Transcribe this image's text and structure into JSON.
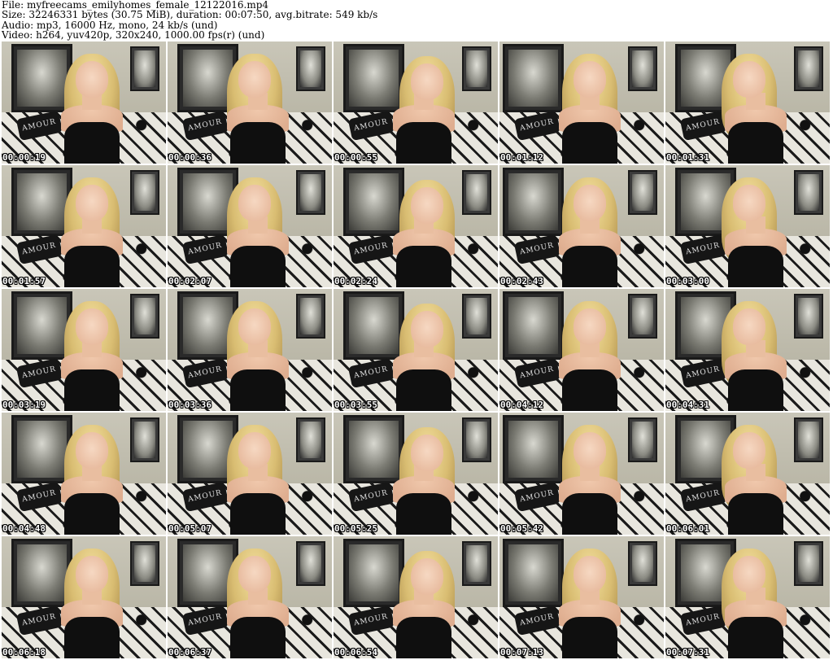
{
  "header": {
    "file_line": "File: myfreecams_emilyhomes_female_12122016.mp4",
    "size_line": "Size: 32246331 bytes (30.75 MiB), duration: 00:07:50, avg.bitrate: 549 kb/s",
    "audio_line": "Audio: mp3, 16000 Hz, mono, 24 kb/s (und)",
    "video_line": "Video: h264, yuv420p, 320x240, 1000.00 fps(r) (und)"
  },
  "thumbnail_text": {
    "pillow_text": "AMOUR"
  },
  "thumbnails": [
    {
      "timestamp": "00:00:19"
    },
    {
      "timestamp": "00:00:36"
    },
    {
      "timestamp": "00:00:55"
    },
    {
      "timestamp": "00:01:12"
    },
    {
      "timestamp": "00:01:31"
    },
    {
      "timestamp": "00:01:57"
    },
    {
      "timestamp": "00:02:07"
    },
    {
      "timestamp": "00:02:24"
    },
    {
      "timestamp": "00:02:43"
    },
    {
      "timestamp": "00:03:00"
    },
    {
      "timestamp": "00:03:19"
    },
    {
      "timestamp": "00:03:36"
    },
    {
      "timestamp": "00:03:55"
    },
    {
      "timestamp": "00:04:12"
    },
    {
      "timestamp": "00:04:31"
    },
    {
      "timestamp": "00:04:48"
    },
    {
      "timestamp": "00:05:07"
    },
    {
      "timestamp": "00:05:25"
    },
    {
      "timestamp": "00:05:42"
    },
    {
      "timestamp": "00:06:01"
    },
    {
      "timestamp": "00:06:18"
    },
    {
      "timestamp": "00:06:37"
    },
    {
      "timestamp": "00:06:54"
    },
    {
      "timestamp": "00:07:13"
    },
    {
      "timestamp": "00:07:31"
    }
  ]
}
